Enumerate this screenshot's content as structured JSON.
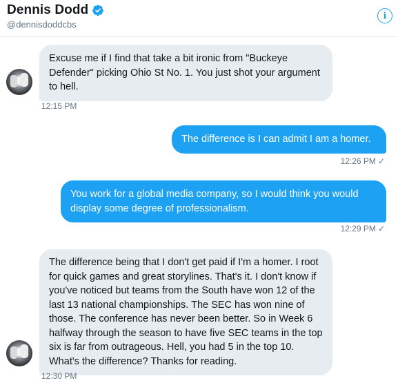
{
  "header": {
    "name": "Dennis Dodd",
    "handle": "@dennisdoddcbs",
    "verified_icon": "verified-badge-icon",
    "info_icon": "info-icon",
    "accent": "#1da1f2"
  },
  "messages": [
    {
      "direction": "received",
      "text": "Excuse me if I find that take a bit ironic from \"Buckeye Defender\" picking Ohio St No. 1. You just shot your argument to hell.",
      "time": "12:15 PM"
    },
    {
      "direction": "sent",
      "text": "The difference is I can admit I am a homer.",
      "time": "12:26 PM",
      "status": "✓"
    },
    {
      "direction": "sent",
      "text": "You work for a global media company, so I would think you would display some degree of professionalism.",
      "time": "12:29 PM",
      "status": "✓"
    },
    {
      "direction": "received",
      "text": "The difference being that I don't get paid if I'm a homer. I root for quick games and great storylines. That's it. I don't know if you've noticed but teams from the South have won 12 of the last 13 national championships. The SEC has won nine of those. The conference has never been better. So in Week 6 halfway through the season to have five SEC teams in the top six is far from outrageous. Hell, you had 5 in the top 10. What's the difference? Thanks for reading.",
      "time": "12:30 PM"
    }
  ],
  "colors": {
    "received_bubble": "#e6ecf0",
    "sent_bubble": "#1da1f2",
    "muted_text": "#657786"
  }
}
